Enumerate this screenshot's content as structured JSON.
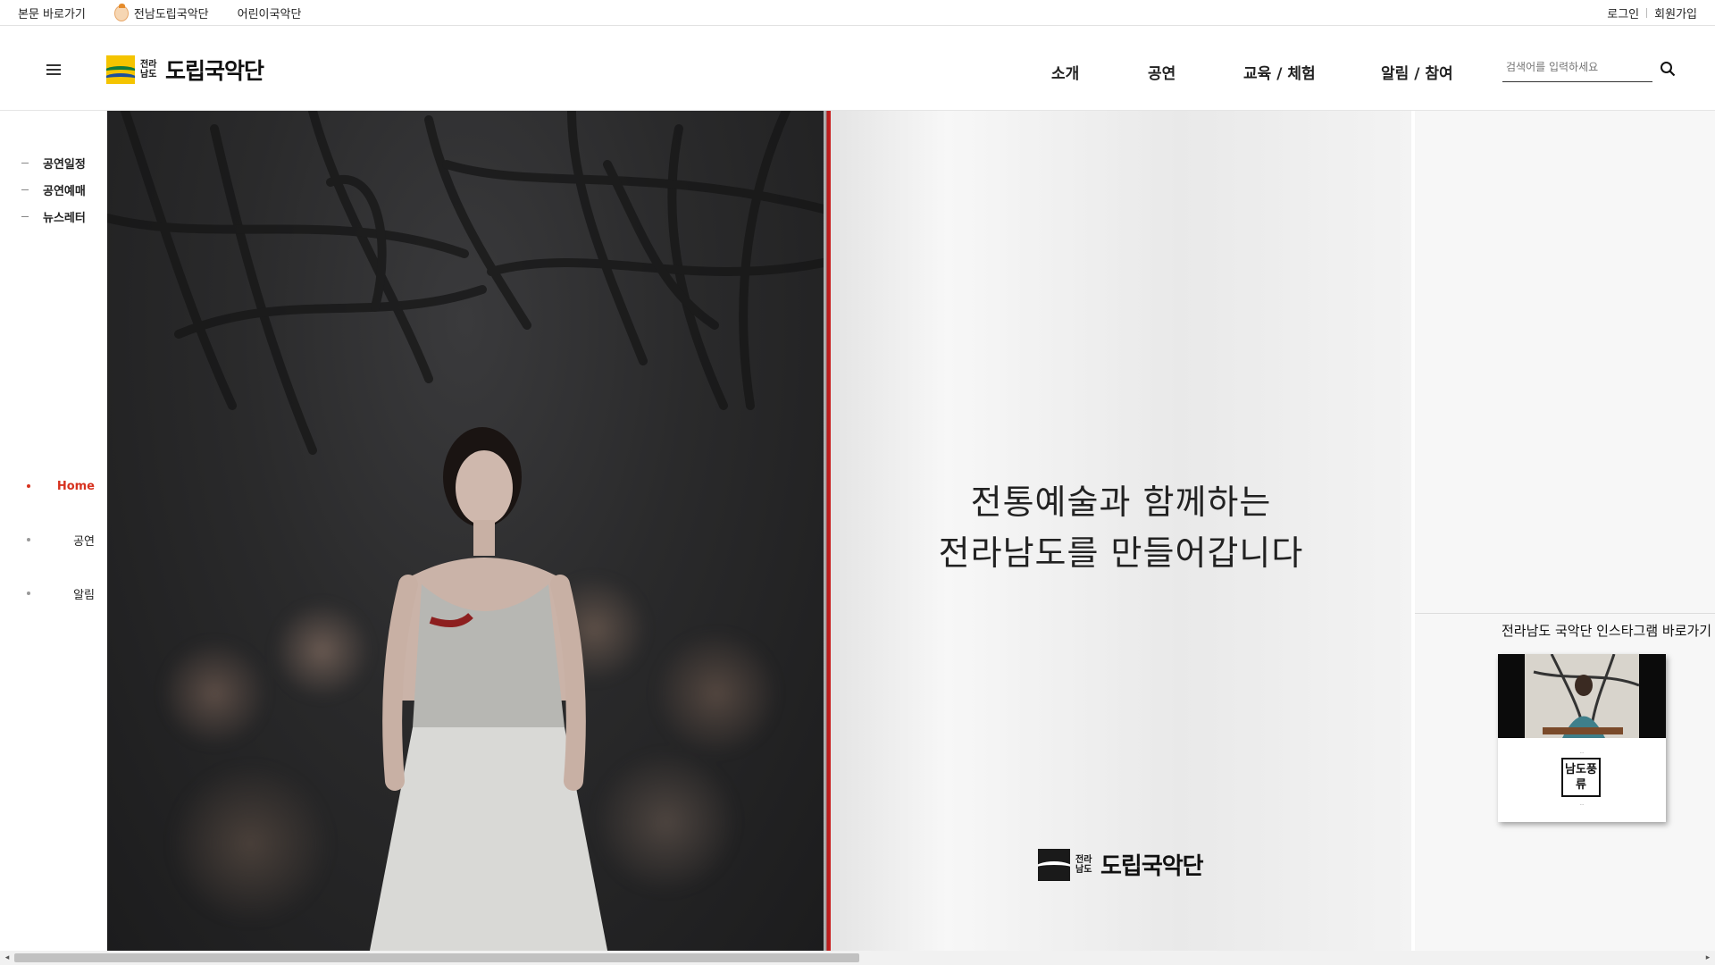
{
  "utility": {
    "skip_link": "본문 바로가기",
    "site_links": [
      "전남도립국악단",
      "어린이국악단"
    ],
    "login": "로그인",
    "signup": "회원가입"
  },
  "header": {
    "logo_small": "전라남도",
    "logo_text": "도립국악단",
    "menu": [
      "소개",
      "공연",
      "교육 / 체험",
      "알림 / 참여"
    ],
    "search_placeholder": "검색어를 입력하세요"
  },
  "subnav": [
    "공연일정",
    "공연예매",
    "뉴스레터"
  ],
  "section_nav": {
    "items": [
      "Home",
      "공연",
      "알림"
    ],
    "active": "Home",
    "accent_color": "#d7321f"
  },
  "visual": {
    "slogan_line1": "전통예술과 함께하는",
    "slogan_line2": "전라남도를 만들어갑니다",
    "poster_logo_small": "전라남도",
    "poster_logo_text": "도립국악단"
  },
  "instagram": {
    "title": "전라남도 국악단 인스타그램 바로가기",
    "card_title": "남도풍류"
  }
}
